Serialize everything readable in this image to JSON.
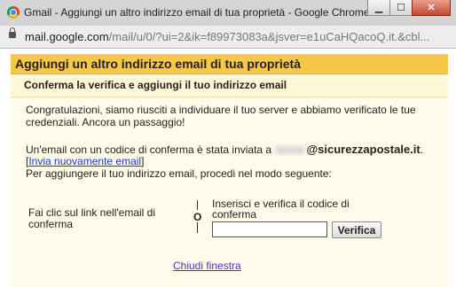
{
  "window": {
    "title": "Gmail - Aggiungi un altro indirizzo email di tua proprietà - Google Chrome",
    "controls": {
      "minimize": "▁",
      "maximize": "☐",
      "close": "✕"
    }
  },
  "address_bar": {
    "host": "mail.google.com",
    "path": "/mail/u/0/?ui=2&ik=f89973083a&jsver=e1uCaHQacoQ.it.&cbl..."
  },
  "dialog": {
    "title": "Aggiungi un altro indirizzo email di tua proprietà",
    "subtitle": "Conferma la verifica e aggiungi il tuo indirizzo email",
    "intro": "Congratulazioni, siamo riusciti a individuare il tuo server e abbiamo verificato le tue credenziali. Ancora un passaggio!",
    "sent_text": "Un'email con un codice di conferma è stata inviata a",
    "email_domain": "@sicurezzapostale.it",
    "email_suffix": ".",
    "resend_link": "Invia nuovamente email",
    "instructions": "Per aggiungere il tuo indirizzo email, procedi nel modo seguente:",
    "option_link": "Fai clic sul link nell'email di conferma",
    "or_label": "O",
    "option_code": "Inserisci e verifica il codice di conferma",
    "code_value": "",
    "verify_button": "Verifica",
    "close_link": "Chiudi finestra"
  },
  "icons": {
    "app": "chrome-icon",
    "lock": "lock-icon"
  },
  "colors": {
    "header_bg": "#f7c748",
    "body_bg": "#fffbea",
    "link": "#1a3dc1",
    "visited_link": "#5a2fb8"
  }
}
